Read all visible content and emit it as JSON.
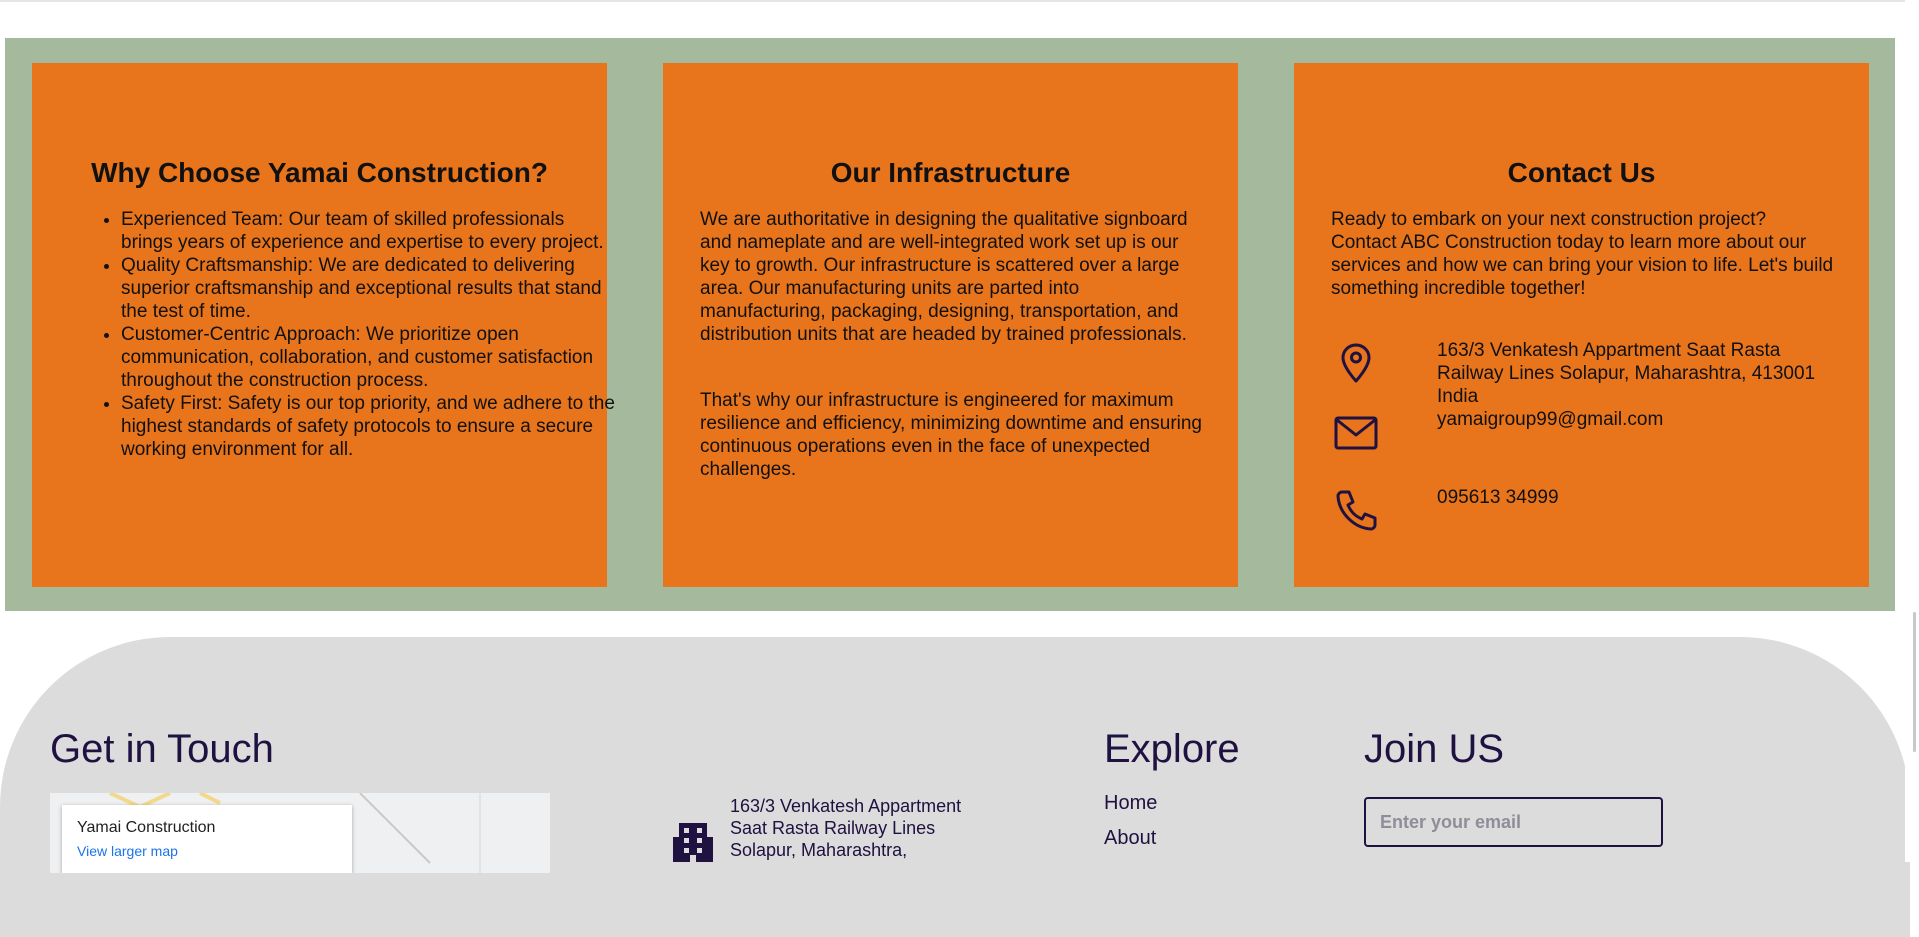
{
  "why": {
    "title": "Why Choose Yamai Construction?",
    "items": [
      "Experienced Team: Our team of skilled professionals brings years of experience and expertise to every project.",
      "Quality Craftsmanship: We are dedicated to delivering superior craftsmanship and exceptional results that stand the test of time.",
      "Customer-Centric Approach: We prioritize open communication, collaboration, and customer satisfaction throughout the construction process.",
      "Safety First: Safety is our top priority, and we adhere to the highest standards of safety protocols to ensure a secure working environment for all."
    ]
  },
  "infrastructure": {
    "title": "Our Infrastructure",
    "paragraphs": [
      "We are authoritative in designing the qualitative signboard and nameplate and are well-integrated work set up is our key to growth. Our infrastructure is scattered over a large area. Our manufacturing units are parted into manufacturing, packaging, designing, transportation, and distribution units that are headed by trained professionals.",
      "That's why our infrastructure is engineered for maximum resilience and efficiency, minimizing downtime and ensuring continuous operations even in the face of unexpected challenges."
    ]
  },
  "contact": {
    "title": "Contact Us",
    "intro": "Ready to embark on your next construction project? Contact ABC Construction today to learn more about our services and how we can bring your vision to life. Let's build something incredible together!",
    "address": "163/3 Venkatesh Appartment Saat Rasta Railway Lines Solapur, Maharashtra, 413001 India",
    "email": "yamaigroup99@gmail.com",
    "phone": "095613 34999",
    "icons": [
      "location-pin-icon",
      "mail-icon",
      "phone-icon"
    ]
  },
  "footer": {
    "get_in_touch": "Get in Touch",
    "map": {
      "place_name": "Yamai Construction",
      "link_text": "View larger map"
    },
    "address": "163/3 Venkatesh Appartment Saat Rasta Railway Lines Solapur, Maharashtra,",
    "explore_title": "Explore",
    "explore_links": [
      "Home",
      "About"
    ],
    "join_title": "Join US",
    "email_placeholder": "Enter your email"
  },
  "colors": {
    "card_orange": "#e8741b",
    "section_green": "#a5b99d",
    "footer_gray": "#dcdcdd",
    "heading_purple": "#1f1140"
  }
}
